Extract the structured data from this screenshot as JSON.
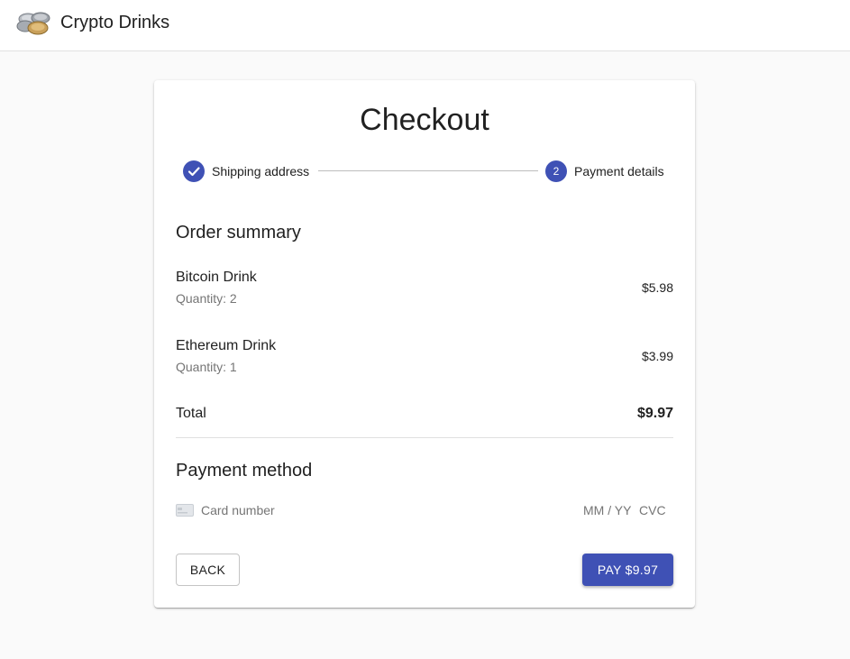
{
  "app": {
    "title": "Crypto Drinks",
    "logo_icon": "coins-icon"
  },
  "checkout": {
    "title": "Checkout",
    "steps": [
      {
        "label": "Shipping address",
        "state": "completed",
        "icon": "check-icon"
      },
      {
        "label": "Payment details",
        "state": "active",
        "number": "2"
      }
    ]
  },
  "order_summary": {
    "title": "Order summary",
    "items": [
      {
        "name": "Bitcoin Drink",
        "quantity": "Quantity: 2",
        "price": "$5.98"
      },
      {
        "name": "Ethereum Drink",
        "quantity": "Quantity: 1",
        "price": "$3.99"
      }
    ],
    "total_label": "Total",
    "total_value": "$9.97"
  },
  "payment_method": {
    "title": "Payment method",
    "card_icon": "credit-card-icon",
    "card_number_placeholder": "Card number",
    "expiry_placeholder": "MM / YY",
    "cvc_placeholder": "CVC"
  },
  "actions": {
    "back_label": "BACK",
    "pay_label": "PAY $9.97"
  },
  "colors": {
    "primary": "#3f51b5",
    "background": "#fafafa",
    "card": "#ffffff"
  }
}
